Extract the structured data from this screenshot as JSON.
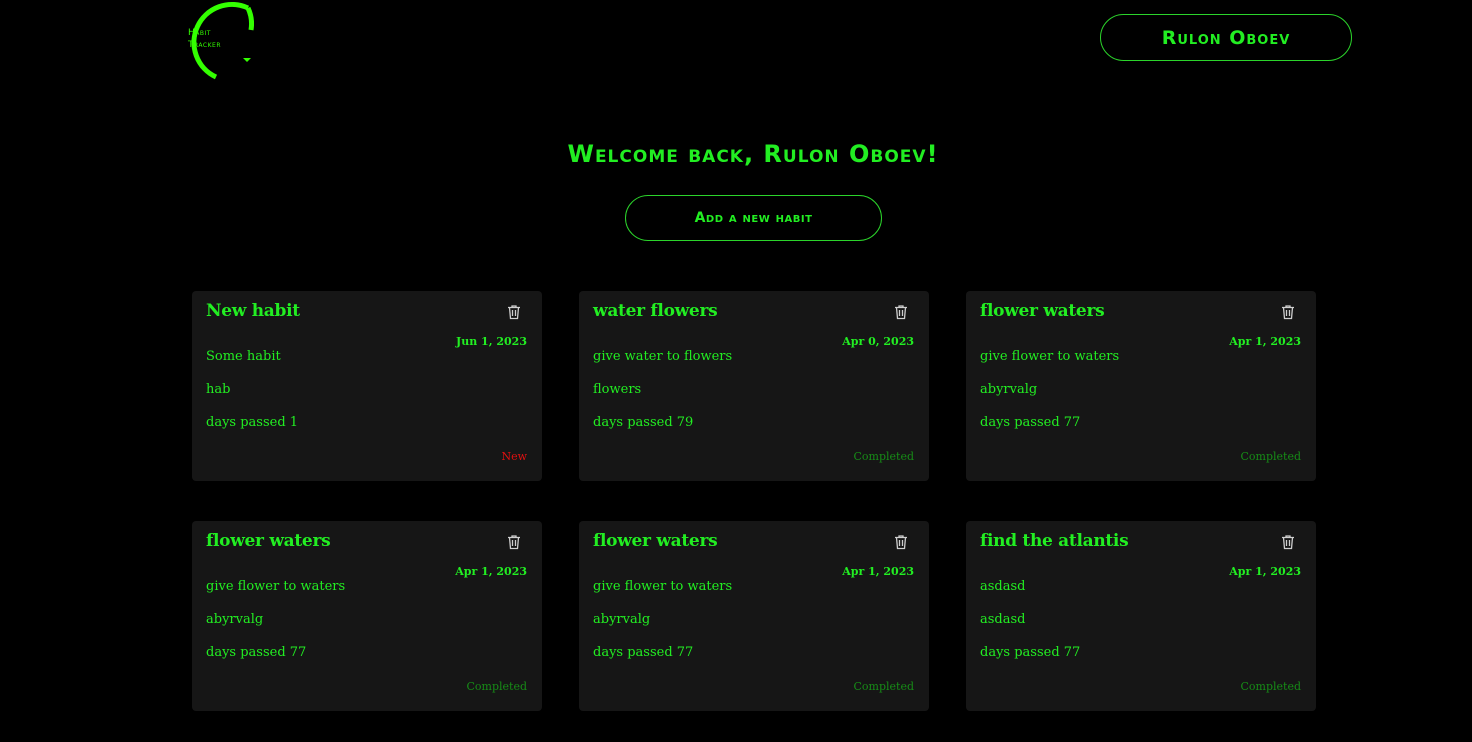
{
  "header": {
    "logo_line1": "Habit",
    "logo_line2": "Tracker",
    "user_button_label": "Rulon Oboev"
  },
  "main": {
    "welcome": "Welcome back, Rulon Oboev!",
    "add_button_label": "Add a new habit"
  },
  "colors": {
    "background": "#000000",
    "accent": "#22ee22",
    "card_background": "#161616",
    "status_new": "#e01010",
    "status_completed": "#168c16"
  },
  "habits": [
    {
      "title": "New habit",
      "date": "Jun 1, 2023",
      "description": "Some habit",
      "category": "hab",
      "days_passed": "days passed 1",
      "status": "New",
      "delete_icon": "trash-icon"
    },
    {
      "title": "water flowers",
      "date": "Apr 0, 2023",
      "description": "give water to flowers",
      "category": "flowers",
      "days_passed": "days passed 79",
      "status": "Completed",
      "delete_icon": "trash-icon"
    },
    {
      "title": "flower waters",
      "date": "Apr 1, 2023",
      "description": "give flower to waters",
      "category": "abyrvalg",
      "days_passed": "days passed 77",
      "status": "Completed",
      "delete_icon": "trash-icon"
    },
    {
      "title": "flower waters",
      "date": "Apr 1, 2023",
      "description": "give flower to waters",
      "category": "abyrvalg",
      "days_passed": "days passed 77",
      "status": "Completed",
      "delete_icon": "trash-icon"
    },
    {
      "title": "flower waters",
      "date": "Apr 1, 2023",
      "description": "give flower to waters",
      "category": "abyrvalg",
      "days_passed": "days passed 77",
      "status": "Completed",
      "delete_icon": "trash-icon"
    },
    {
      "title": "find the atlantis",
      "date": "Apr 1, 2023",
      "description": "asdasd",
      "category": "asdasd",
      "days_passed": "days passed 77",
      "status": "Completed",
      "delete_icon": "trash-icon"
    }
  ]
}
